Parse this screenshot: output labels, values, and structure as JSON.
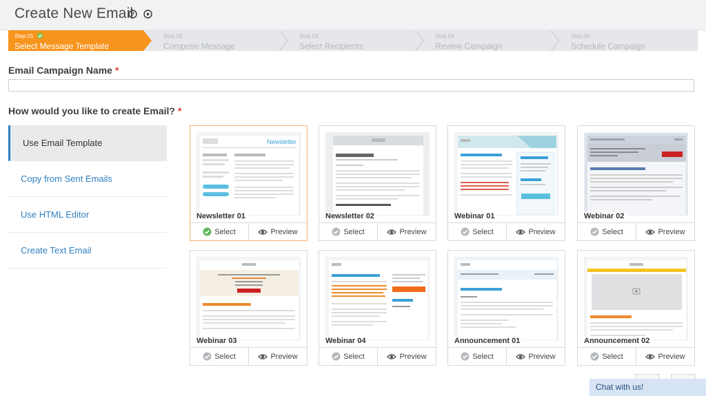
{
  "header": {
    "title": "Create New Email"
  },
  "steps": [
    {
      "num": "Step 01",
      "name": "Select Message Template",
      "active": true,
      "done": true
    },
    {
      "num": "Step 02",
      "name": "Compose Message",
      "active": false
    },
    {
      "num": "Step 03",
      "name": "Select Recipients",
      "active": false
    },
    {
      "num": "Step 04",
      "name": "Review Campaign",
      "active": false
    },
    {
      "num": "Step 05",
      "name": "Schedule Campaign",
      "active": false
    }
  ],
  "form": {
    "campaign_name_label": "Email Campaign Name",
    "required_mark": "*",
    "campaign_name_value": "",
    "create_label": "How would you like to create Email?"
  },
  "options": [
    {
      "label": "Use Email Template",
      "active": true
    },
    {
      "label": "Copy from Sent Emails",
      "active": false
    },
    {
      "label": "Use HTML Editor",
      "active": false
    },
    {
      "label": "Create Text Email",
      "active": false
    }
  ],
  "templates": [
    {
      "name": "Newsletter 01",
      "selected": true
    },
    {
      "name": "Newsletter 02",
      "selected": false
    },
    {
      "name": "Webinar 01",
      "selected": false
    },
    {
      "name": "Webinar 02",
      "selected": false
    },
    {
      "name": "Webinar 03",
      "selected": false
    },
    {
      "name": "Webinar 04",
      "selected": false
    },
    {
      "name": "Announcement 01",
      "selected": false
    },
    {
      "name": "Announcement 02",
      "selected": false
    }
  ],
  "actions": {
    "select": "Select",
    "preview": "Preview"
  },
  "chat": {
    "label": "Chat with us!"
  },
  "colors": {
    "accent": "#f7941d",
    "link": "#2f7fc1",
    "selected_check": "#5cb85c"
  }
}
